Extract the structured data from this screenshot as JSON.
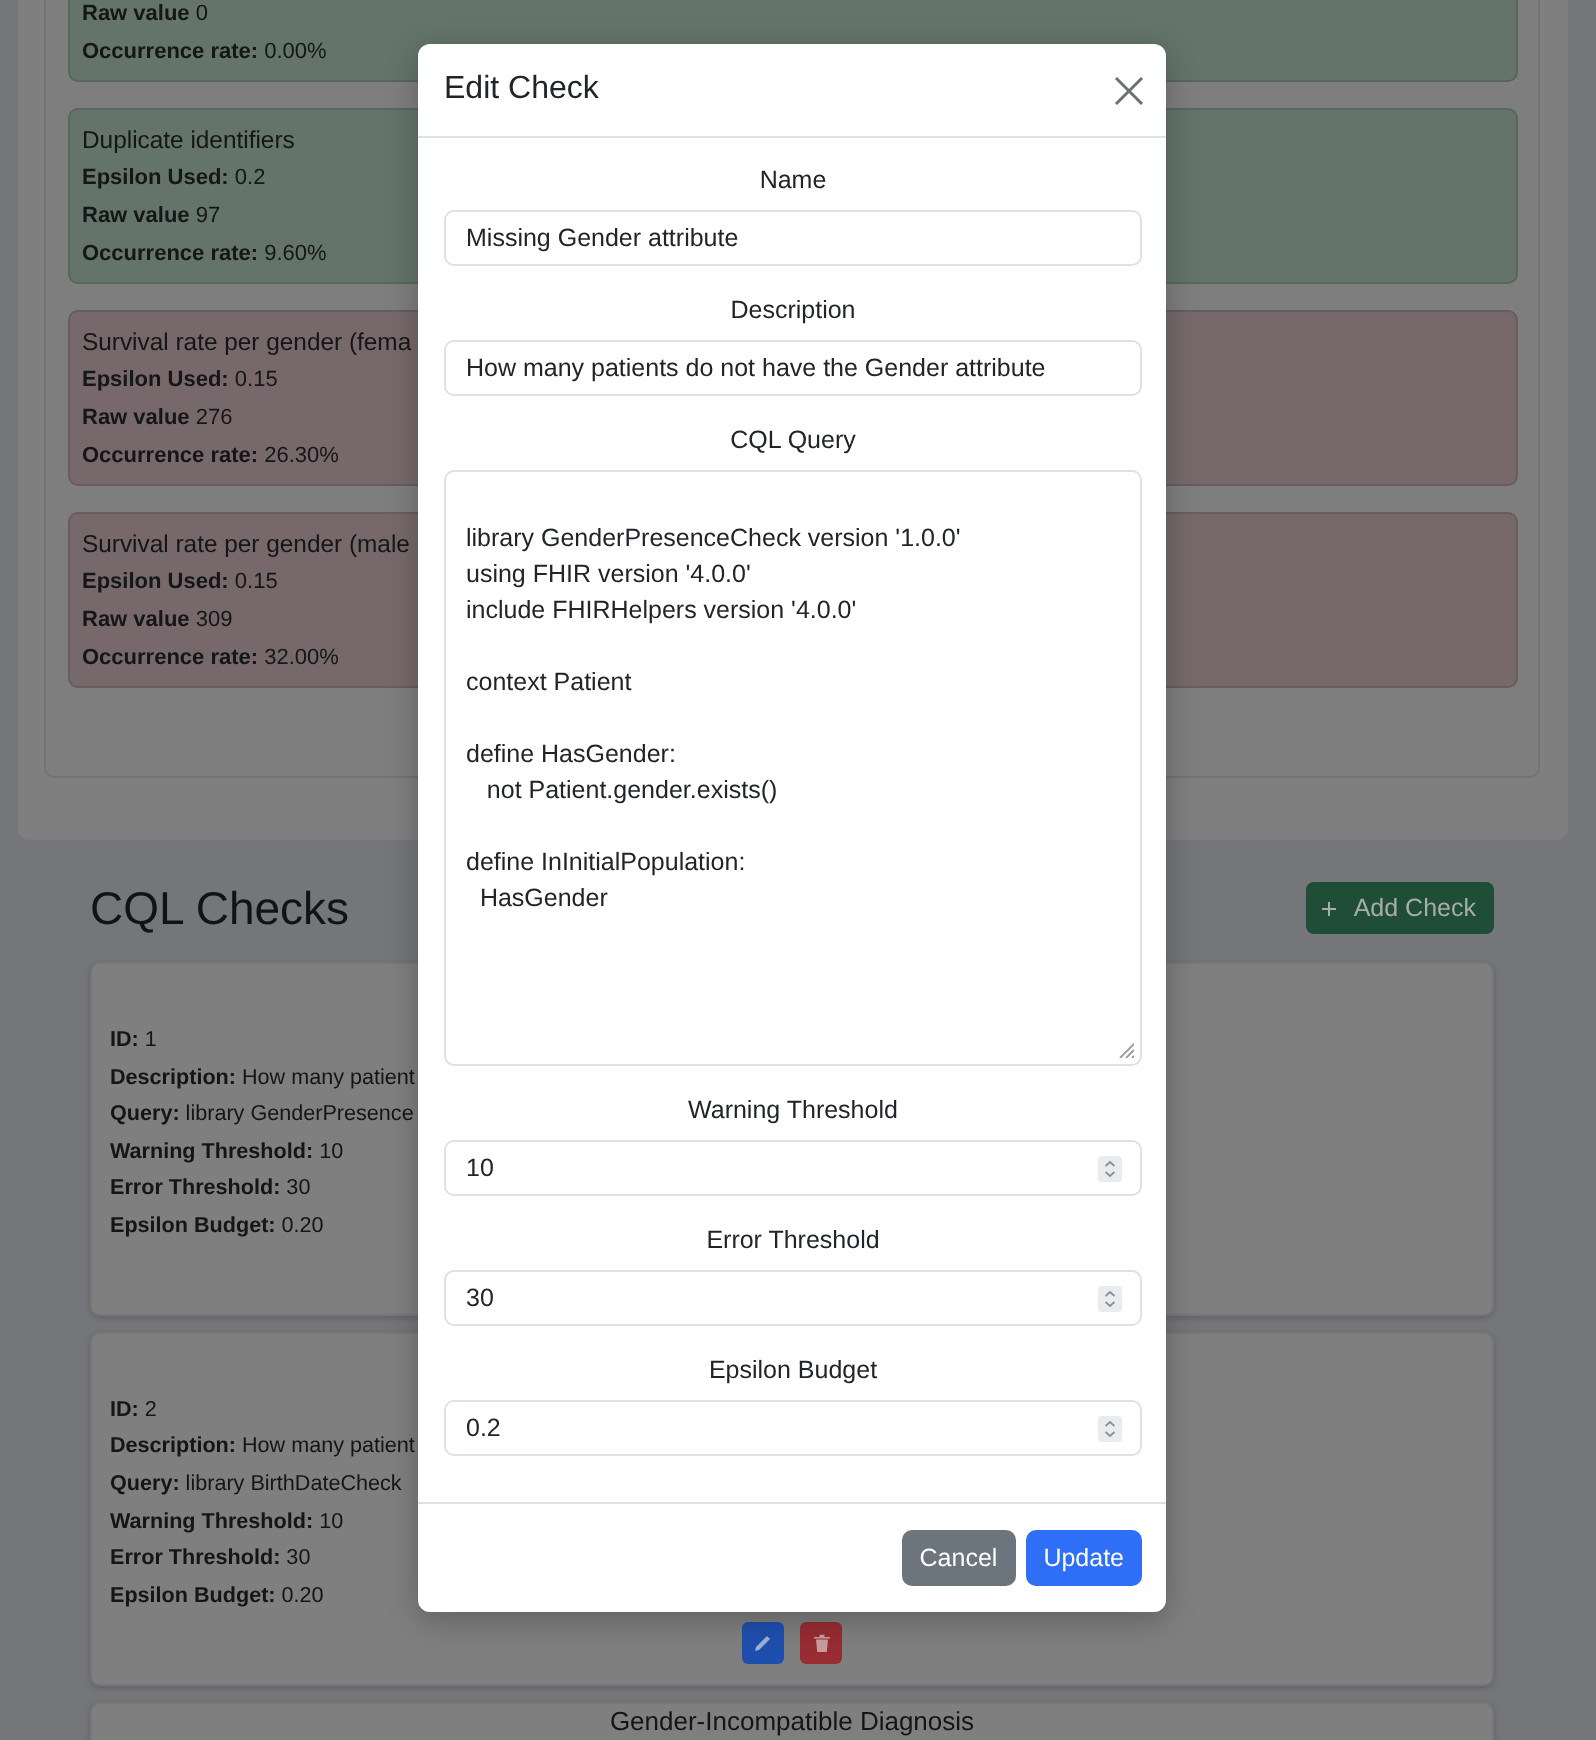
{
  "results_panel": {
    "results": [
      {
        "color": "#64746a",
        "fields": [
          {
            "label": "Raw value",
            "value": "0"
          },
          {
            "label": "Occurrence rate:",
            "value": "0.00%"
          }
        ]
      },
      {
        "title": "Duplicate identifiers",
        "color": "#64746a",
        "fields": [
          {
            "label": "Epsilon Used:",
            "value": "0.2"
          },
          {
            "label": "Raw value",
            "value": "97"
          },
          {
            "label": "Occurrence rate:",
            "value": "9.60%"
          }
        ]
      },
      {
        "title": "Survival rate per gender (fema",
        "color": "#77696b",
        "fields": [
          {
            "label": "Epsilon Used:",
            "value": "0.15"
          },
          {
            "label": "Raw value",
            "value": "276"
          },
          {
            "label": "Occurrence rate:",
            "value": "26.30%"
          }
        ]
      },
      {
        "title": "Survival rate per gender (male",
        "color": "#77696b",
        "fields": [
          {
            "label": "Epsilon Used:",
            "value": "0.15"
          },
          {
            "label": "Raw value",
            "value": "309"
          },
          {
            "label": "Occurrence rate:",
            "value": "32.00%"
          }
        ]
      }
    ]
  },
  "cql_checks": {
    "title": "CQL Checks",
    "add_button": "Add Check",
    "checks": [
      {
        "fields": [
          {
            "label": "ID:",
            "value": "1"
          },
          {
            "label": "Description:",
            "value": "How many patient"
          },
          {
            "label": "Query:",
            "value": "library GenderPresence"
          },
          {
            "label": "Warning Threshold:",
            "value": "10"
          },
          {
            "label": "Error Threshold:",
            "value": "30"
          },
          {
            "label": "Epsilon Budget:",
            "value": "0.20"
          }
        ]
      },
      {
        "fields": [
          {
            "label": "ID:",
            "value": "2"
          },
          {
            "label": "Description:",
            "value": "How many patient"
          },
          {
            "label": "Query:",
            "value": "library BirthDateCheck"
          },
          {
            "label": "Warning Threshold:",
            "value": "10"
          },
          {
            "label": "Error Threshold:",
            "value": "30"
          },
          {
            "label": "Epsilon Budget:",
            "value": "0.20"
          }
        ],
        "actions": [
          {
            "kind": "edit"
          },
          {
            "kind": "delete"
          }
        ]
      },
      {
        "title": "Gender-Incompatible Diagnosis"
      }
    ]
  },
  "modal": {
    "title": "Edit Check",
    "fields": [
      {
        "label": "Name",
        "kind": "text",
        "value": "Missing Gender attribute"
      },
      {
        "label": "Description",
        "kind": "text",
        "value": "How many patients do not have the Gender attribute"
      },
      {
        "label": "CQL Query",
        "kind": "textarea",
        "value": "\nlibrary GenderPresenceCheck version '1.0.0'\nusing FHIR version '4.0.0'\ninclude FHIRHelpers version '4.0.0'\n\ncontext Patient\n\ndefine HasGender:\n   not Patient.gender.exists()\n\ndefine InInitialPopulation:\n  HasGender"
      },
      {
        "label": "Warning Threshold",
        "kind": "number",
        "value": "10"
      },
      {
        "label": "Error Threshold",
        "kind": "number",
        "value": "30"
      },
      {
        "label": "Epsilon Budget",
        "kind": "number",
        "value": "0.2"
      }
    ],
    "buttons": [
      {
        "label": "Cancel",
        "kind": "cancel"
      },
      {
        "label": "Update",
        "kind": "submit"
      }
    ]
  }
}
